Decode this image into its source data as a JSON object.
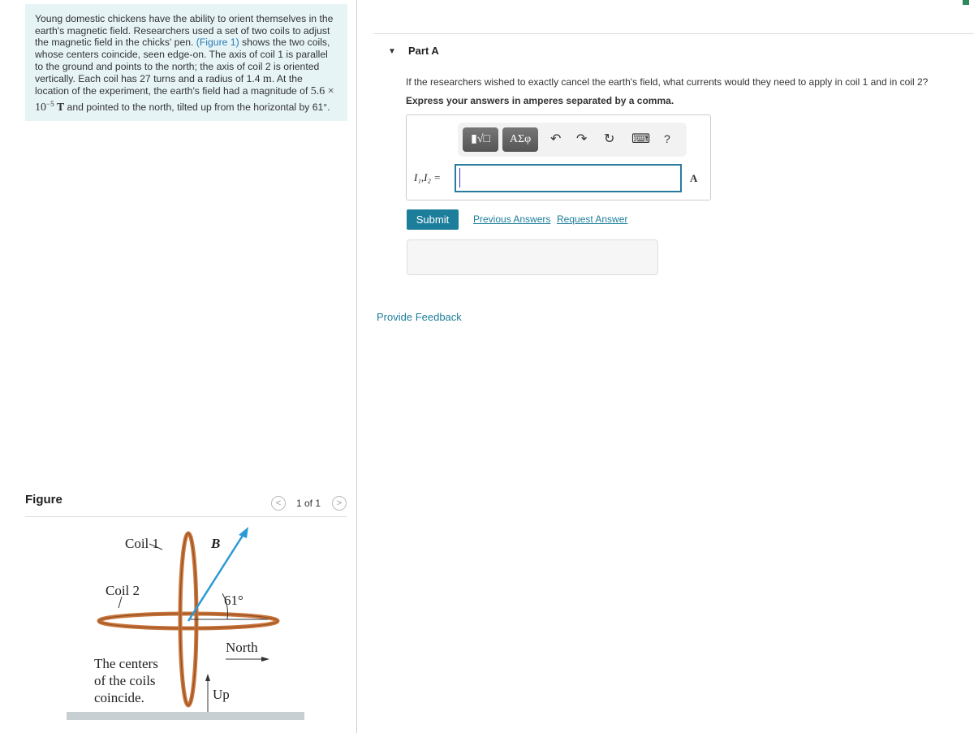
{
  "problem": {
    "text_before_link": "Young domestic chickens have the ability to orient themselves in the earth's magnetic field. Researchers used a set of two coils to adjust the magnetic field in the chicks' pen. ",
    "link": "(Figure 1)",
    "text_after_link": " shows the two coils, whose centers coincide, seen edge-on. The axis of coil 1 is parallel to the ground and points to the north; the axis of coil 2 is oriented vertically. Each coil has 27 turns and a radius of 1.4 ",
    "radius_unit": "m",
    "text_mid": ". At the location of the experiment, the earth's field had a magnitude of ",
    "field_value": "5.6 × 10",
    "field_exp": "−5",
    "field_unit": " T",
    "text_end": " and pointed to the north, tilted up from the horizontal by 61°."
  },
  "figure": {
    "label": "Figure",
    "pager": "1 of 1",
    "prev": "<",
    "next": ">",
    "coil1": "Coil 1",
    "coil2": "Coil 2",
    "b": "B",
    "angle": "61°",
    "north": "North",
    "up": "Up",
    "note_lines": [
      "The centers",
      "of the coils",
      "coincide."
    ],
    "colors": {
      "coil": "#c8743a",
      "field": "#2a9ad6"
    }
  },
  "part": {
    "title": "Part A",
    "question": "If the researchers wished to exactly cancel the earth's field, what currents would they need to apply in coil 1 and in coil 2?",
    "instruction": "Express your answers in amperes separated by a comma.",
    "eq_label": "I₁,I₂ =",
    "input_value": "",
    "unit": "A",
    "toolbar": {
      "templates": "▮√□",
      "greek": "ΑΣφ",
      "undo": "↶",
      "redo": "↷",
      "reset": "↻",
      "keyboard": "⌨",
      "help": "?"
    },
    "submit": "Submit",
    "previous_answers": "Previous Answers",
    "request_answer": "Request Answer"
  },
  "provide_feedback": "Provide Feedback"
}
